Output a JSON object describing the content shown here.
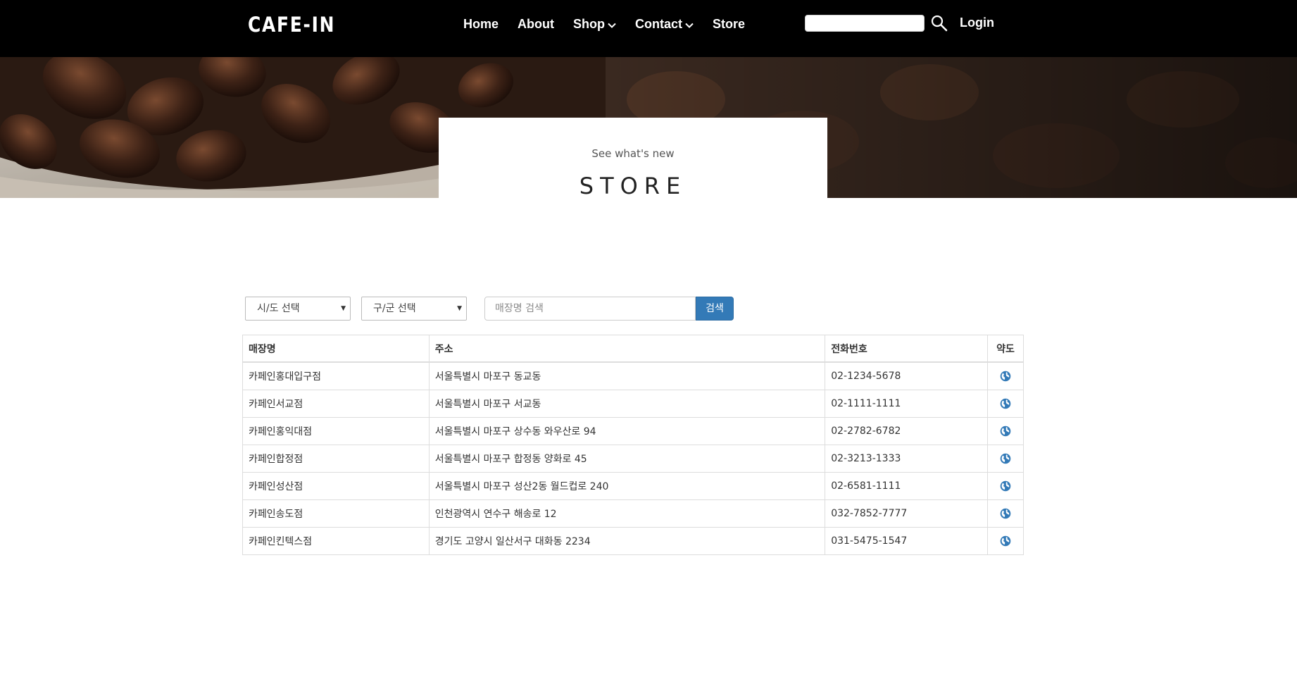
{
  "navbar": {
    "logo": "CAFE-IN",
    "links": [
      {
        "label": "Home"
      },
      {
        "label": "About"
      },
      {
        "label": "Shop",
        "has_dropdown": true
      },
      {
        "label": "Contact",
        "has_dropdown": true
      },
      {
        "label": "Store"
      }
    ],
    "search_icon": "search-icon",
    "login_label": "Login"
  },
  "hero": {
    "subtitle": "See what's new",
    "title": "STORE"
  },
  "filters": {
    "sido_label": "시/도 선택",
    "gugun_label": "구/군 선택",
    "store_search_placeholder": "매장명 검색",
    "search_button_label": "검색",
    "accent_color": "#337ab7"
  },
  "table": {
    "headers": {
      "name": "매장명",
      "address": "주소",
      "phone": "전화번호",
      "map": "약도"
    },
    "map_icon": "globe-icon",
    "rows": [
      {
        "name": "카페인홍대입구점",
        "address": "서울특별시 마포구 동교동",
        "phone": "02-1234-5678"
      },
      {
        "name": "카페인서교점",
        "address": "서울특별시 마포구 서교동",
        "phone": "02-1111-1111"
      },
      {
        "name": "카페인홍익대점",
        "address": "서울특별시 마포구 상수동 와우산로 94",
        "phone": "02-2782-6782"
      },
      {
        "name": "카페인합정점",
        "address": "서울특별시 마포구 합정동 양화로 45",
        "phone": "02-3213-1333"
      },
      {
        "name": "카페인성산점",
        "address": "서울특별시 마포구 성산2동 월드컵로 240",
        "phone": "02-6581-1111"
      },
      {
        "name": "카페인송도점",
        "address": "인천광역시 연수구 해송로 12",
        "phone": "032-7852-7777"
      },
      {
        "name": "카페인킨텍스점",
        "address": "경기도 고양시 일산서구 대화동 2234",
        "phone": "031-5475-1547"
      }
    ]
  }
}
